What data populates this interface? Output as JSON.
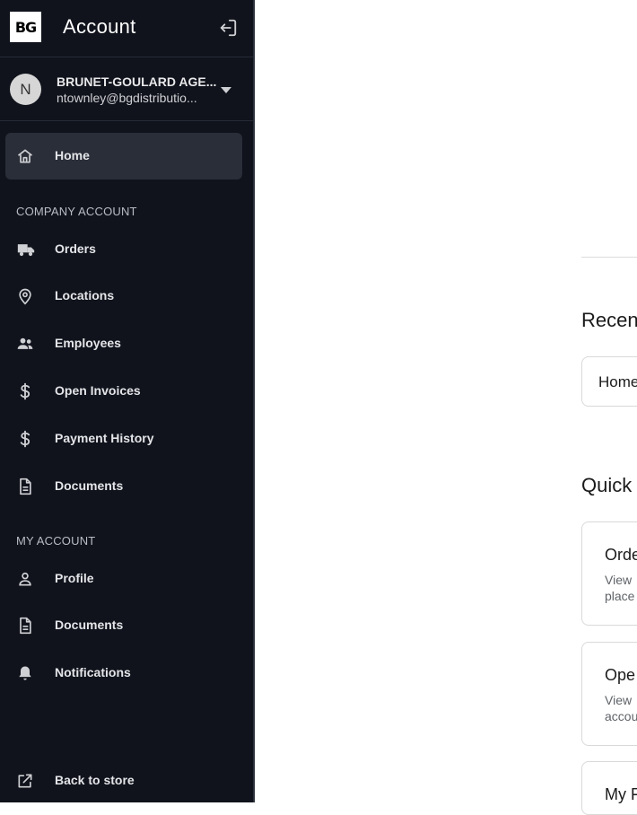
{
  "header": {
    "logo_text": "BG",
    "title": "Account",
    "logout_icon": "logout-icon"
  },
  "account": {
    "avatar_initial": "N",
    "name": "BRUNET-GOULARD AGE...",
    "email": "ntownley@bgdistributio...",
    "menu_icon": "chevron-down-icon"
  },
  "nav": {
    "home": {
      "label": "Home",
      "icon": "home-icon"
    },
    "company_section": "COMPANY ACCOUNT",
    "company_items": [
      {
        "label": "Orders",
        "icon": "truck-icon"
      },
      {
        "label": "Locations",
        "icon": "location-pin-icon"
      },
      {
        "label": "Employees",
        "icon": "people-icon"
      },
      {
        "label": "Open Invoices",
        "icon": "dollar-icon"
      },
      {
        "label": "Payment History",
        "icon": "dollar-icon"
      },
      {
        "label": "Documents",
        "icon": "document-icon"
      }
    ],
    "my_section": "MY ACCOUNT",
    "my_items": [
      {
        "label": "Profile",
        "icon": "person-icon"
      },
      {
        "label": "Documents",
        "icon": "document-icon"
      },
      {
        "label": "Notifications",
        "icon": "bell-icon"
      }
    ],
    "back": {
      "label": "Back to store",
      "icon": "external-link-icon"
    }
  },
  "main": {
    "recent_title": "Recent",
    "recent_item": "Home",
    "quick_title": "Quick",
    "cards": [
      {
        "title": "Orde",
        "desc_line1": "View",
        "desc_line2": "place"
      },
      {
        "title": "Ope",
        "desc_line1": "View",
        "desc_line2": "accou"
      },
      {
        "title": "My F"
      }
    ]
  }
}
